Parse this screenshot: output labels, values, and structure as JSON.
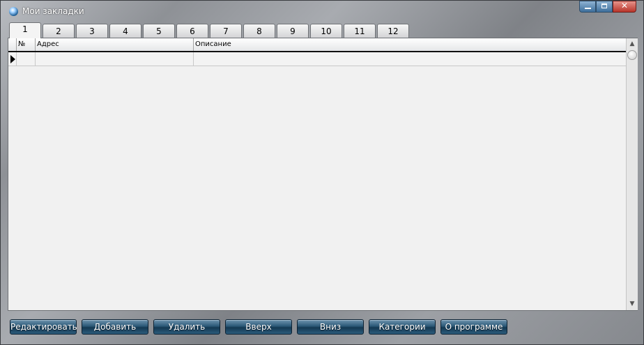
{
  "window": {
    "title": "Мои закладки"
  },
  "tabs": [
    "1",
    "2",
    "3",
    "4",
    "5",
    "6",
    "7",
    "8",
    "9",
    "10",
    "11",
    "12"
  ],
  "active_tab": "1",
  "grid": {
    "columns": [
      "№",
      "Адрес",
      "Описание"
    ],
    "rows": [
      {
        "num": "",
        "address": "",
        "description": ""
      }
    ]
  },
  "buttons": {
    "edit": "Редактировать",
    "add": "Добавить",
    "delete": "Удалить",
    "up": "Вверх",
    "down": "Вниз",
    "categories": "Категории",
    "about": "О программе"
  },
  "colors": {
    "button_accent": "#2b5876",
    "grid_background": "#f1f1f1",
    "close_button": "#b8352b"
  }
}
